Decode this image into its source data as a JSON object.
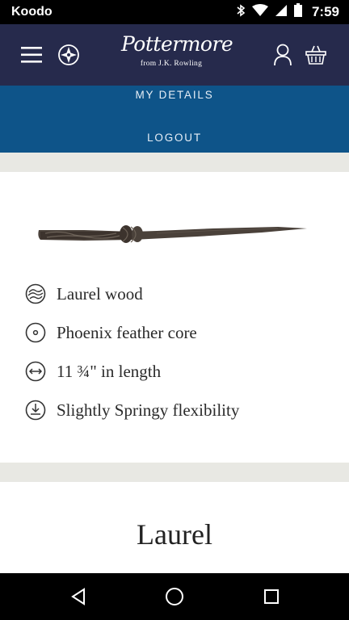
{
  "status_bar": {
    "carrier": "Koodo",
    "time": "7:59"
  },
  "header": {
    "logo_text": "Pottermore",
    "logo_sub": "from J.K. Rowling"
  },
  "dropdown": {
    "my_details": "MY DETAILS",
    "logout": "LOGOUT"
  },
  "wand": {
    "attributes": [
      {
        "icon": "wood-grain-icon",
        "text": "Laurel wood"
      },
      {
        "icon": "core-icon",
        "text": "Phoenix feather core"
      },
      {
        "icon": "length-icon",
        "text": "11 ¾\" in length"
      },
      {
        "icon": "flexibility-icon",
        "text": "Slightly Springy flexibility"
      }
    ]
  },
  "wood": {
    "title": "Laurel"
  },
  "colors": {
    "header_bg": "#262a4c",
    "dropdown_bg": "#0e5489",
    "gap_bg": "#e8e8e3"
  }
}
